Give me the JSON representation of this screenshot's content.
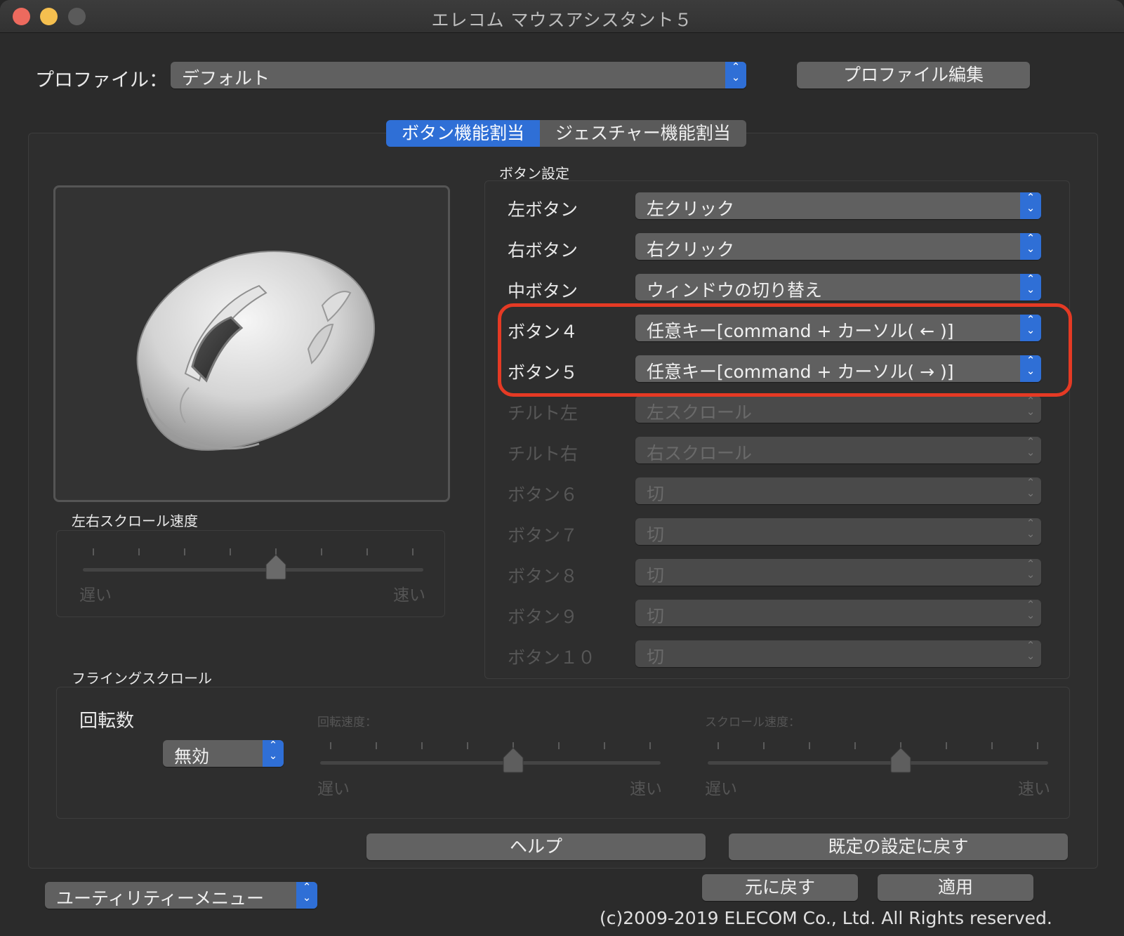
{
  "window": {
    "title": "エレコム マウスアシスタント５"
  },
  "profile": {
    "label": "プロファイル：",
    "value": "デフォルト",
    "edit_button": "プロファイル編集"
  },
  "tabs": [
    {
      "label": "ボタン機能割当",
      "active": true
    },
    {
      "label": "ジェスチャー機能割当",
      "active": false
    }
  ],
  "button_settings": {
    "title": "ボタン設定",
    "rows": [
      {
        "label": "左ボタン",
        "value": "左クリック",
        "enabled": true
      },
      {
        "label": "右ボタン",
        "value": "右クリック",
        "enabled": true
      },
      {
        "label": "中ボタン",
        "value": "ウィンドウの切り替え",
        "enabled": true
      },
      {
        "label": "ボタン４",
        "value": "任意キー[command + カーソル( ← )]",
        "enabled": true
      },
      {
        "label": "ボタン５",
        "value": "任意キー[command + カーソル( → )]",
        "enabled": true
      },
      {
        "label": "チルト左",
        "value": "左スクロール",
        "enabled": false
      },
      {
        "label": "チルト右",
        "value": "右スクロール",
        "enabled": false
      },
      {
        "label": "ボタン６",
        "value": "切",
        "enabled": false
      },
      {
        "label": "ボタン７",
        "value": "切",
        "enabled": false
      },
      {
        "label": "ボタン８",
        "value": "切",
        "enabled": false
      },
      {
        "label": "ボタン９",
        "value": "切",
        "enabled": false
      },
      {
        "label": "ボタン１０",
        "value": "切",
        "enabled": false
      }
    ]
  },
  "hscroll": {
    "title": "左右スクロール速度",
    "slow": "遅い",
    "fast": "速い",
    "level": 0.5
  },
  "flying_scroll": {
    "title": "フライングスクロール",
    "rotations_label": "回転数",
    "rotations_value": "無効",
    "rotation_speed": {
      "label": "回転速度：",
      "slow": "遅い",
      "fast": "速い",
      "level": 0.57
    },
    "scroll_speed": {
      "label": "スクロール速度：",
      "slow": "遅い",
      "fast": "速い",
      "level": 0.57
    }
  },
  "actions": {
    "help": "ヘルプ",
    "reset_default": "既定の設定に戻す",
    "revert": "元に戻す",
    "apply": "適用"
  },
  "utility_menu": "ユーティリティーメニュー",
  "copyright": "(c)2009-2019 ELECOM Co., Ltd. All Rights reserved.",
  "colors": {
    "accent": "#2f6fd6",
    "highlight": "#e53a24"
  }
}
